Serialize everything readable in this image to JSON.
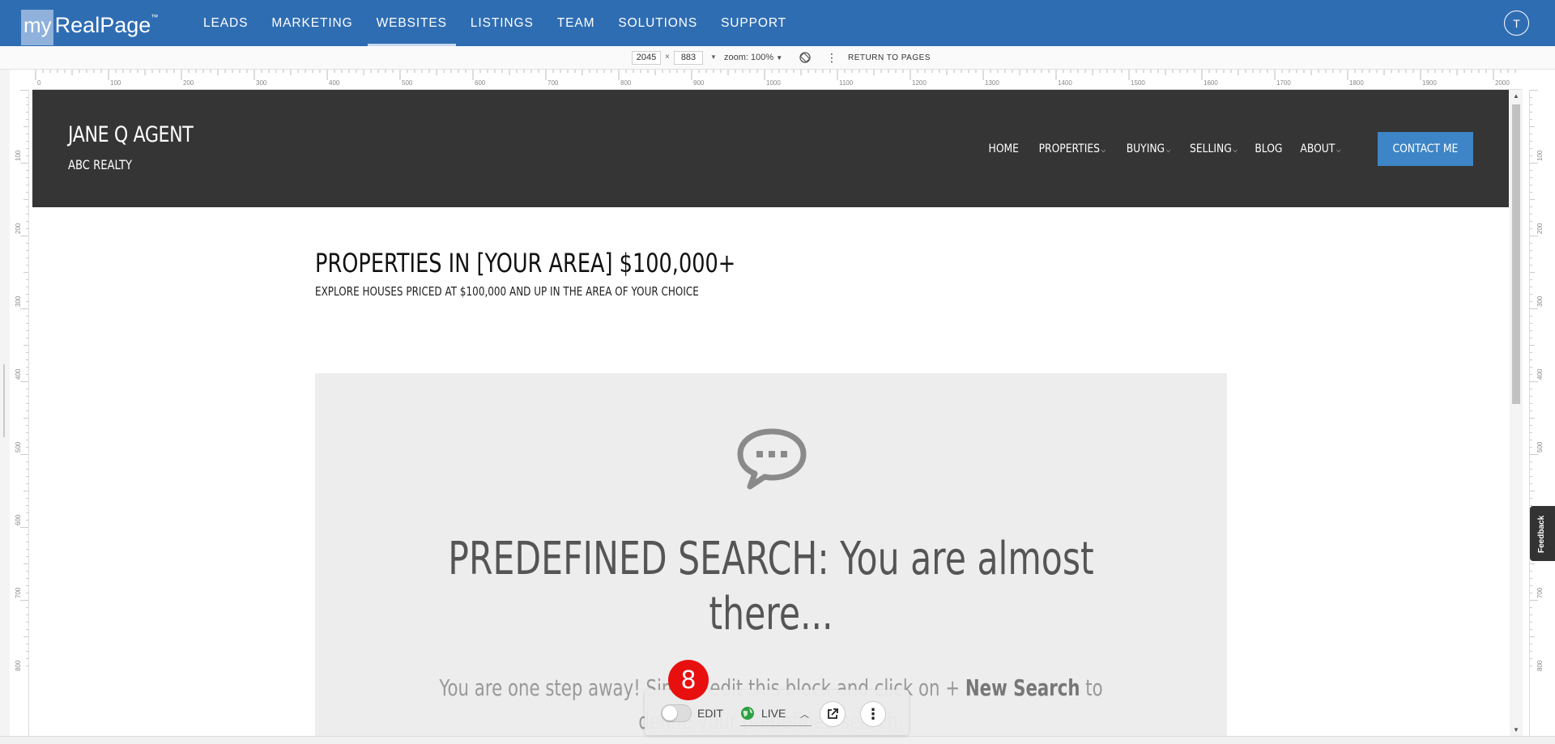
{
  "topnav": {
    "logo_my": "my",
    "logo_rest": "RealPage",
    "logo_tm": "™",
    "items": [
      {
        "label": "LEADS"
      },
      {
        "label": "MARKETING"
      },
      {
        "label": "WEBSITES",
        "active": true
      },
      {
        "label": "LISTINGS"
      },
      {
        "label": "TEAM"
      },
      {
        "label": "SOLUTIONS"
      },
      {
        "label": "SUPPORT"
      }
    ],
    "avatar_initial": "T",
    "color": "#2f6db3"
  },
  "toolbar": {
    "width_value": "2045",
    "times": "×",
    "height_value": "883",
    "zoom_label": "zoom: 100%",
    "return_label": "RETURN TO PAGES"
  },
  "ruler": {
    "top_ticks": [
      "0",
      "100",
      "200",
      "300",
      "400",
      "500",
      "600",
      "700",
      "800",
      "900",
      "1000",
      "1100",
      "1200",
      "1300",
      "1400",
      "1500",
      "1600",
      "1700",
      "1800",
      "1900",
      "2000"
    ],
    "side_ticks": [
      "100",
      "200",
      "300",
      "400",
      "500",
      "600",
      "700",
      "800"
    ]
  },
  "site": {
    "name": "JANE Q AGENT",
    "subtitle": "ABC REALTY",
    "menu": [
      {
        "label": "HOME",
        "has_caret": false
      },
      {
        "label": "PROPERTIES",
        "has_caret": true
      },
      {
        "label": "BUYING",
        "has_caret": true
      },
      {
        "label": "SELLING",
        "has_caret": true
      },
      {
        "label": "BLOG",
        "has_caret": false
      },
      {
        "label": "ABOUT",
        "has_caret": true
      }
    ],
    "contact_label": "CONTACT ME",
    "header_color": "#353535",
    "accent_color": "#3d85c6"
  },
  "page": {
    "title": "PROPERTIES IN [YOUR AREA] $100,000+",
    "subtitle": "EXPLORE HOUSES PRICED AT $100,000 AND UP IN THE AREA OF YOUR CHOICE"
  },
  "predefined": {
    "icon": "chat-bubble-icon",
    "title": "PREDEFINED SEARCH: You are almost there...",
    "body_pre": "You are one step away! Simply edit this block and click on + ",
    "body_bold": "New Search",
    "body_post": " to define your predefined search."
  },
  "feedback": {
    "label": "Feedback"
  },
  "editbar": {
    "edit_label": "EDIT",
    "live_label": "LIVE",
    "edit_toggle_on": false,
    "badge_number": "8",
    "badge_color": "#e8100f"
  }
}
